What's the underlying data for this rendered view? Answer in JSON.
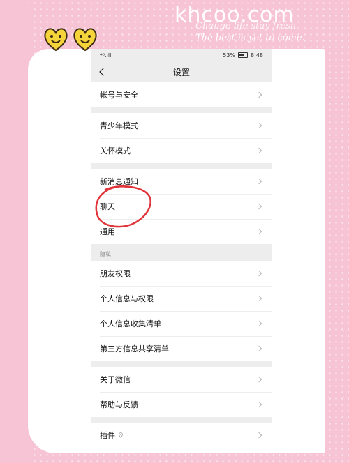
{
  "watermark": {
    "site": "khcoo.com",
    "tagline_1": "Change life stay fresh",
    "tagline_2": "The best is yet to come."
  },
  "status_bar": {
    "signal": "⁴ᴳ.ıll",
    "battery": "53%",
    "time": "8:48"
  },
  "nav": {
    "title": "设置"
  },
  "groups": [
    {
      "items": [
        {
          "label": "帐号与安全"
        }
      ]
    },
    {
      "items": [
        {
          "label": "青少年模式"
        },
        {
          "label": "关怀模式"
        }
      ]
    },
    {
      "items": [
        {
          "label": "新消息通知"
        },
        {
          "label": "聊天"
        },
        {
          "label": "通用"
        }
      ]
    },
    {
      "section_label": "隐私",
      "items": [
        {
          "label": "朋友权限"
        },
        {
          "label": "个人信息与权限"
        },
        {
          "label": "个人信息收集清单"
        },
        {
          "label": "第三方信息共享清单"
        }
      ]
    },
    {
      "items": [
        {
          "label": "关于微信"
        },
        {
          "label": "帮助与反馈"
        }
      ]
    },
    {
      "items": [
        {
          "label": "插件",
          "icon": "location-pin-icon"
        }
      ]
    }
  ],
  "annotation": {
    "highlighted_item": "聊天",
    "color": "#e0343a"
  },
  "colors": {
    "background_pink": "#f7c4d6",
    "page_gray": "#ededed",
    "accent_red": "#e0343a"
  }
}
